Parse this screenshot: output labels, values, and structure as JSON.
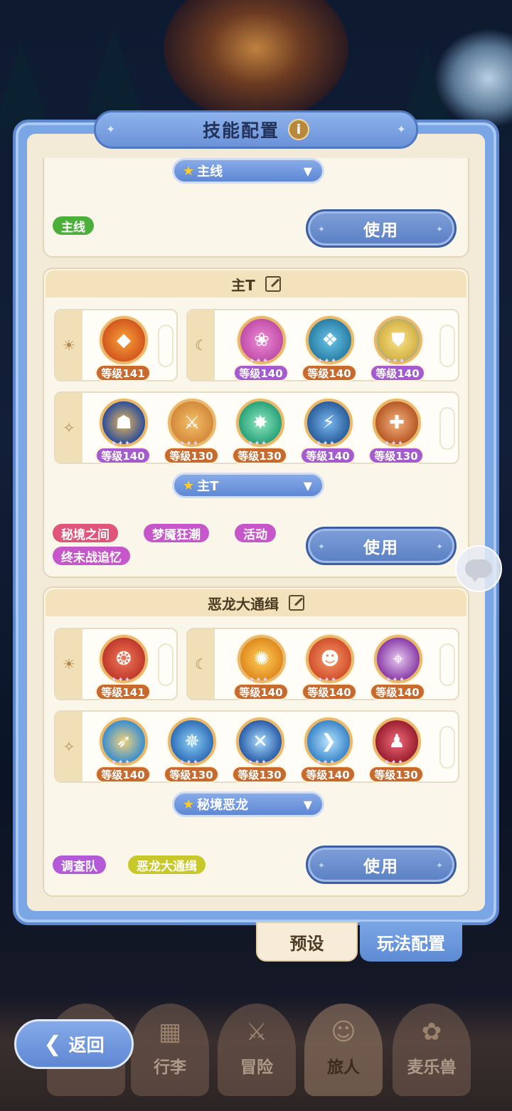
{
  "title": "技能配置",
  "info_icon": "i",
  "cards": [
    {
      "preset": "主线",
      "tags": [
        {
          "label": "主线",
          "color": "#4caf3a"
        }
      ],
      "use_label": "使用"
    },
    {
      "name": "主T",
      "groups": [
        {
          "symbol": "☀",
          "skills": [
            {
              "level": "等级141",
              "color": "#d4571e",
              "lvl_style": "orange"
            }
          ]
        },
        {
          "symbol": "☾",
          "skills": [
            {
              "level": "等级140",
              "color": "#c04fa8",
              "lvl_style": "purple"
            },
            {
              "level": "等级140",
              "color": "#2c7fa6",
              "lvl_style": "orange"
            },
            {
              "level": "等级140",
              "color": "#d9b64a",
              "lvl_style": "purple"
            }
          ]
        },
        {
          "symbol": "✧",
          "skills": [
            {
              "level": "等级140",
              "color": "#2f4f99",
              "lvl_style": "purple"
            },
            {
              "level": "等级130",
              "color": "#d38a3b",
              "lvl_style": "orange"
            },
            {
              "level": "等级130",
              "color": "#2aa37a",
              "lvl_style": "orange"
            },
            {
              "level": "等级140",
              "color": "#2a5f9c",
              "lvl_style": "purple"
            },
            {
              "level": "等级130",
              "color": "#b85a2a",
              "lvl_style": "purple"
            }
          ]
        }
      ],
      "preset": "主T",
      "tags": [
        {
          "label": "秘境之间",
          "color": "#e0567a"
        },
        {
          "label": "梦魇狂潮",
          "color": "#c656c9"
        },
        {
          "label": "活动",
          "color": "#c656c9"
        },
        {
          "label": "终末战追忆",
          "color": "#c656c9"
        }
      ],
      "use_label": "使用"
    },
    {
      "name": "恶龙大通缉",
      "groups": [
        {
          "symbol": "☀",
          "skills": [
            {
              "level": "等级141",
              "color": "#c0392b",
              "lvl_style": "orange"
            }
          ]
        },
        {
          "symbol": "☾",
          "skills": [
            {
              "level": "等级140",
              "color": "#e08a1f",
              "lvl_style": "orange"
            },
            {
              "level": "等级140",
              "color": "#d2502e",
              "lvl_style": "orange"
            },
            {
              "level": "等级140",
              "color": "#8a3ea8",
              "lvl_style": "orange"
            }
          ]
        },
        {
          "symbol": "✧",
          "skills": [
            {
              "level": "等级140",
              "color": "#3a8fd0",
              "lvl_style": "orange"
            },
            {
              "level": "等级130",
              "color": "#2f6fb8",
              "lvl_style": "orange"
            },
            {
              "level": "等级130",
              "color": "#2b5ea8",
              "lvl_style": "orange"
            },
            {
              "level": "等级140",
              "color": "#3a86c9",
              "lvl_style": "orange"
            },
            {
              "level": "等级130",
              "color": "#9a2030",
              "lvl_style": "orange"
            }
          ]
        }
      ],
      "preset": "秘境恶龙",
      "tags": [
        {
          "label": "调查队",
          "color": "#b35ad8"
        },
        {
          "label": "恶龙大通缉",
          "color": "#c9c82a"
        }
      ],
      "use_label": "使用"
    }
  ],
  "tabs": {
    "preset": "预设",
    "gameplay": "玩法配置"
  },
  "back_label": "返回",
  "nav": [
    {
      "label": "行李",
      "icon": "backpack-icon"
    },
    {
      "label": "冒险",
      "icon": "swords-icon"
    },
    {
      "label": "旅人",
      "icon": "traveler-icon"
    },
    {
      "label": "麦乐兽",
      "icon": "pet-icon"
    }
  ]
}
